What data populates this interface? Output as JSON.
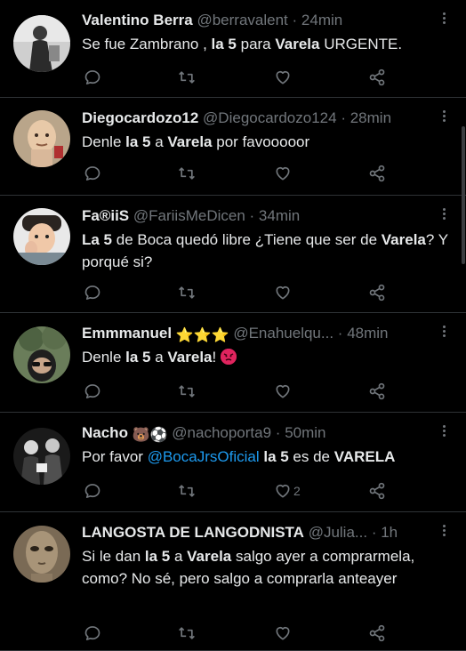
{
  "tweets": [
    {
      "name": "Valentino Berra",
      "name_suffix": "",
      "handle": "@berravalent",
      "dot": "·",
      "time": "24min",
      "parts": [
        {
          "t": "Se fue Zambrano , "
        },
        {
          "b": "la 5"
        },
        {
          "t": " para "
        },
        {
          "b": "Varela"
        },
        {
          "t": " URGENTE."
        }
      ],
      "like_count": ""
    },
    {
      "name": "Diegocardozo12",
      "name_suffix": "",
      "handle": "@Diegocardozo124",
      "dot": "·",
      "time": "28min",
      "parts": [
        {
          "t": "Denle "
        },
        {
          "b": "la 5"
        },
        {
          "t": " a "
        },
        {
          "b": "Varela"
        },
        {
          "t": " por favooooor"
        }
      ],
      "like_count": ""
    },
    {
      "name": "Fa®iiS",
      "name_suffix": "",
      "handle": "@FariisMeDicen",
      "dot": "·",
      "time": "34min",
      "parts": [
        {
          "b": "La 5"
        },
        {
          "t": " de Boca quedó libre ¿Tiene que ser de "
        },
        {
          "b": "Varela"
        },
        {
          "t": "? Y porqué si?"
        }
      ],
      "like_count": ""
    },
    {
      "name": "Emmmanuel",
      "name_suffix": "⭐⭐⭐",
      "handle": "@Enahuelqu...",
      "dot": "·",
      "time": "48min",
      "parts": [
        {
          "t": "Denle "
        },
        {
          "b": "la 5"
        },
        {
          "t": " a "
        },
        {
          "b": "Varela"
        },
        {
          "t": "! "
        }
      ],
      "trailing_emoji": "angry-face",
      "like_count": ""
    },
    {
      "name": "Nacho",
      "name_suffix": "🐻⚽",
      "handle": "@nachoporta9",
      "dot": "·",
      "time": "50min",
      "parts": [
        {
          "t": "Por favor "
        },
        {
          "m": "@BocaJrsOficial"
        },
        {
          "t": " "
        },
        {
          "b": "la 5"
        },
        {
          "t": " es de "
        },
        {
          "b": "VARELA"
        }
      ],
      "like_count": "2"
    },
    {
      "name": "LANGOSTA DE LANGODNISTA",
      "name_suffix": "",
      "handle": "@Julia...",
      "dot": "·",
      "time": "1h",
      "parts": [
        {
          "t": "Si le dan "
        },
        {
          "b": "la 5"
        },
        {
          "t": " a "
        },
        {
          "b": "Varela"
        },
        {
          "t": " salgo ayer a comprarmela, como? No sé, pero salgo a comprarla anteayer"
        }
      ],
      "like_count": ""
    }
  ],
  "colors": {
    "background": "#000000",
    "text": "#e7e9ea",
    "muted": "#71767b",
    "mention": "#1d9bf0",
    "divider": "#2f3336"
  },
  "icons": [
    "reply-icon",
    "retweet-icon",
    "like-icon",
    "share-icon",
    "more-icon"
  ]
}
